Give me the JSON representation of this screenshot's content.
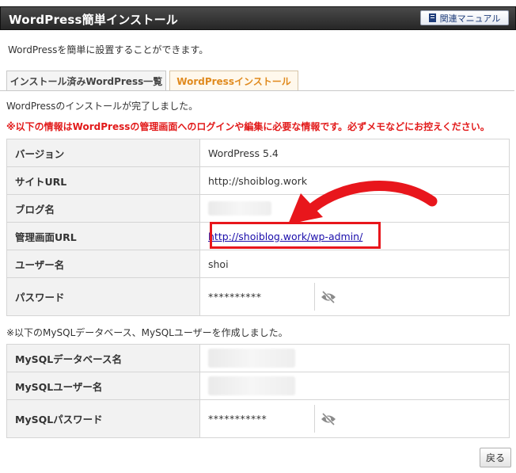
{
  "header": {
    "title": "WordPress簡単インストール",
    "manual_label": "関連マニュアル"
  },
  "intro": "WordPressを簡単に設置することができます。",
  "tabs": [
    {
      "label": "インストール済みWordPress一覧",
      "active": false
    },
    {
      "label": "WordPressインストール",
      "active": true
    }
  ],
  "messages": {
    "done": "WordPressのインストールが完了しました。",
    "warning": "※以下の情報はWordPressの管理画面へのログインや編集に必要な情報です。必ずメモなどにお控えください。"
  },
  "wp_info": {
    "version_label": "バージョン",
    "version_value": "WordPress 5.4",
    "site_url_label": "サイトURL",
    "site_url_value": "http://shoiblog.work",
    "blog_name_label": "ブログ名",
    "admin_url_label": "管理画面URL",
    "admin_url_value": "http://shoiblog.work/wp-admin/",
    "user_label": "ユーザー名",
    "user_value": "shoi",
    "password_label": "パスワード",
    "password_value": "**********"
  },
  "mysql_note": "※以下のMySQLデータベース、MySQLユーザーを作成しました。",
  "mysql_info": {
    "db_label": "MySQLデータベース名",
    "user_label": "MySQLユーザー名",
    "password_label": "MySQLパスワード",
    "password_value": "***********"
  },
  "back_label": "戻る",
  "colors": {
    "warning": "#e21a1a",
    "annotation": "#e8161c",
    "active_tab": "#e08a1e",
    "link": "#1a0dab"
  },
  "icons": {
    "manual": "book-icon",
    "password_toggle": "eye-slash-icon"
  }
}
